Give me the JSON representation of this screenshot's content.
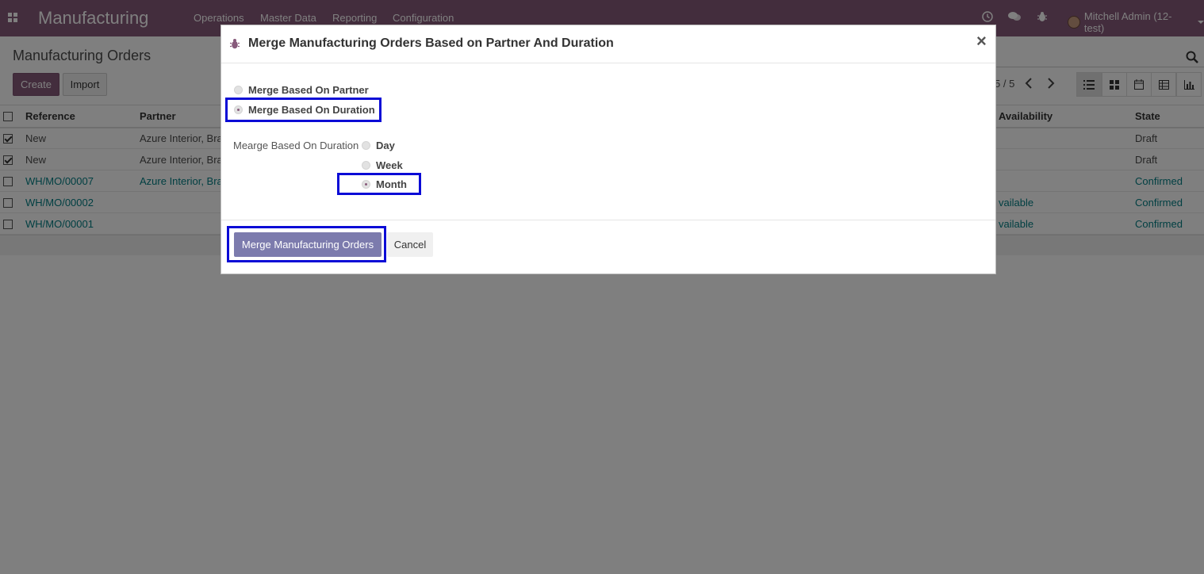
{
  "navbar": {
    "app_title": "Manufacturing",
    "menu": [
      "Operations",
      "Master Data",
      "Reporting",
      "Configuration"
    ],
    "user": "Mitchell Admin (12-test)"
  },
  "control_panel": {
    "title": "Manufacturing Orders",
    "create_label": "Create",
    "import_label": "Import",
    "pager": "5 / 5"
  },
  "table": {
    "columns": [
      "Reference",
      "Partner",
      "Availability",
      "State"
    ],
    "rows": [
      {
        "checked": true,
        "reference": "New",
        "partner": "Azure Interior, Bra",
        "availability": "",
        "state": "Draft"
      },
      {
        "checked": true,
        "reference": "New",
        "partner": "Azure Interior, Bra",
        "availability": "",
        "state": "Draft"
      },
      {
        "checked": false,
        "reference": "WH/MO/00007",
        "partner": "Azure Interior, Bra",
        "availability": "",
        "state": "Confirmed"
      },
      {
        "checked": false,
        "reference": "WH/MO/00002",
        "partner": "",
        "availability": "vailable",
        "state": "Confirmed"
      },
      {
        "checked": false,
        "reference": "WH/MO/00001",
        "partner": "",
        "availability": "vailable",
        "state": "Confirmed"
      }
    ]
  },
  "modal": {
    "title": "Merge Manufacturing Orders Based on Partner And Duration",
    "close": "×",
    "merge_options": [
      {
        "label": "Merge Based On Partner",
        "selected": false
      },
      {
        "label": "Merge Based On Duration",
        "selected": true
      }
    ],
    "duration_label": "Mearge Based On Duration",
    "duration_options": [
      {
        "label": "Day",
        "selected": false
      },
      {
        "label": "Week",
        "selected": false
      },
      {
        "label": "Month",
        "selected": true
      }
    ],
    "merge_button": "Merge Manufacturing Orders",
    "cancel_button": "Cancel"
  },
  "colors": {
    "brand": "#875a7b",
    "primary_button": "#7c7bad",
    "highlight": "#0b0bd6",
    "link": "#017e84"
  }
}
